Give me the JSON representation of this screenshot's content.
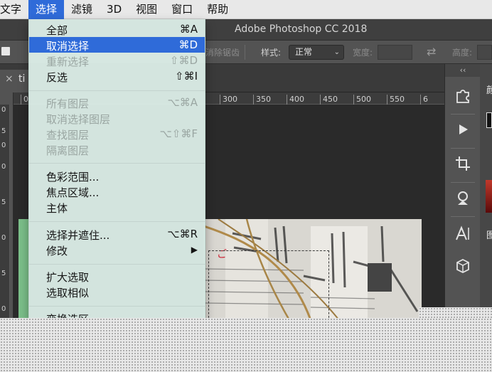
{
  "menubar": {
    "items": [
      "文字",
      "选择",
      "滤镜",
      "3D",
      "视图",
      "窗口",
      "帮助"
    ],
    "active_index": 1
  },
  "window": {
    "title": "Adobe Photoshop CC 2018"
  },
  "options": {
    "antialias_label": "消除锯齿",
    "style_label": "样式:",
    "style_value": "正常",
    "width_label": "宽度:",
    "height_label": "高度:"
  },
  "doc_tab": {
    "name": "ti"
  },
  "ruler": {
    "h_ticks": [
      "300",
      "350",
      "400",
      "450",
      "500",
      "550",
      "6"
    ],
    "h_first": "0"
  },
  "select_menu": {
    "items": [
      {
        "label": "全部",
        "shortcut": "⌘A",
        "state": "normal"
      },
      {
        "label": "取消选择",
        "shortcut": "⌘D",
        "state": "highlighted"
      },
      {
        "label": "重新选择",
        "shortcut": "⇧⌘D",
        "state": "disabled"
      },
      {
        "label": "反选",
        "shortcut": "⇧⌘I",
        "state": "normal"
      },
      {
        "label": "所有图层",
        "shortcut": "⌥⌘A",
        "state": "disabled"
      },
      {
        "label": "取消选择图层",
        "shortcut": "",
        "state": "disabled"
      },
      {
        "label": "查找图层",
        "shortcut": "⌥⇧⌘F",
        "state": "disabled"
      },
      {
        "label": "隔离图层",
        "shortcut": "",
        "state": "disabled"
      },
      {
        "label": "色彩范围...",
        "shortcut": "",
        "state": "normal"
      },
      {
        "label": "焦点区域...",
        "shortcut": "",
        "state": "normal"
      },
      {
        "label": "主体",
        "shortcut": "",
        "state": "normal"
      },
      {
        "label": "选择并遮住...",
        "shortcut": "⌥⌘R",
        "state": "normal"
      },
      {
        "label": "修改",
        "shortcut": "▶",
        "state": "normal"
      },
      {
        "label": "扩大选取",
        "shortcut": "",
        "state": "normal"
      },
      {
        "label": "选取相似",
        "shortcut": "",
        "state": "normal"
      },
      {
        "label": "变换选区",
        "shortcut": "",
        "state": "normal"
      }
    ]
  },
  "right_panel": {
    "collapse_glyph": "‹‹",
    "icons": [
      "puzzle-icon",
      "play-icon",
      "crop-icon",
      "gallery-icon",
      "character-icon",
      "3d-cube-icon"
    ],
    "side_glyphs": [
      "颜",
      "图"
    ]
  }
}
